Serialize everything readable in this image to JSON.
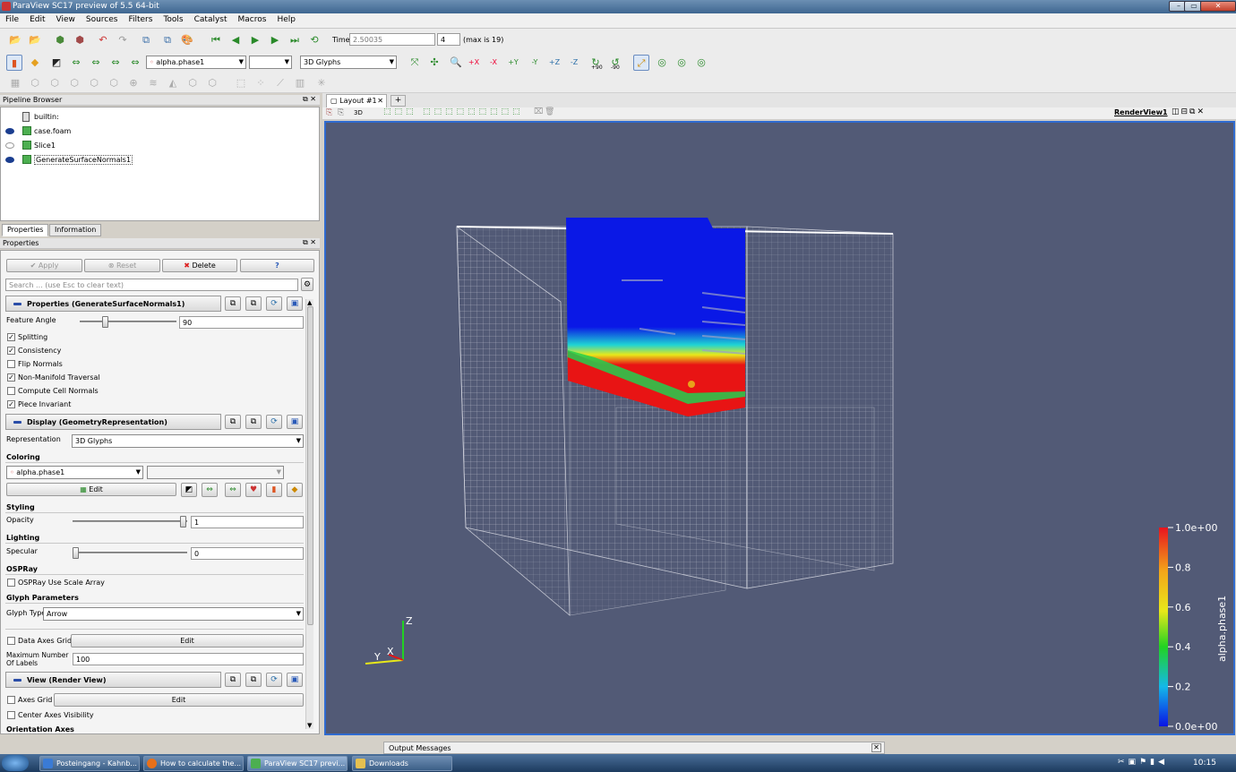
{
  "window": {
    "title": "ParaView SC17 preview of 5.5 64-bit"
  },
  "menu": [
    "File",
    "Edit",
    "View",
    "Sources",
    "Filters",
    "Tools",
    "Catalyst",
    "Macros",
    "Help"
  ],
  "time": {
    "label": "Time:",
    "value": "2.50035",
    "step": "4",
    "max_text": "(max is 19)"
  },
  "toolbar2": {
    "color_array": "alpha.phase1",
    "representation": "3D Glyphs",
    "rot_plus": "+90",
    "rot_minus": "-90"
  },
  "pipeline": {
    "header": "Pipeline Browser",
    "items": [
      "builtin:",
      "case.foam",
      "Slice1",
      "GenerateSurfaceNormals1"
    ]
  },
  "tabs": {
    "properties": "Properties",
    "information": "Information"
  },
  "props": {
    "header": "Properties",
    "apply": "Apply",
    "reset": "Reset",
    "delete": "Delete",
    "help": "?",
    "search_placeholder": "Search ... (use Esc to clear text)",
    "section1": "Properties (GenerateSurfaceNormals1)",
    "feature_angle_label": "Feature Angle",
    "feature_angle_value": "90",
    "feature_angle_fraction": 0.25,
    "checks": [
      {
        "label": "Splitting",
        "checked": true
      },
      {
        "label": "Consistency",
        "checked": true
      },
      {
        "label": "Flip Normals",
        "checked": false
      },
      {
        "label": "Non-Manifold Traversal",
        "checked": true
      },
      {
        "label": "Compute Cell Normals",
        "checked": false
      },
      {
        "label": "Piece Invariant",
        "checked": true
      }
    ],
    "section2": "Display (GeometryRepresentation)",
    "representation_label": "Representation",
    "representation_value": "3D Glyphs",
    "coloring_label": "Coloring",
    "coloring_array": "alpha.phase1",
    "edit_label": "Edit",
    "styling_label": "Styling",
    "opacity_label": "Opacity",
    "opacity_value": "1",
    "opacity_fraction": 1.0,
    "lighting_label": "Lighting",
    "specular_label": "Specular",
    "specular_value": "0",
    "specular_fraction": 0.0,
    "ospray_label": "OSPRay",
    "ospray_scale": "OSPRay Use Scale Array",
    "glyph_params_label": "Glyph Parameters",
    "glyph_type_label": "Glyph Type",
    "glyph_type_value": "Arrow",
    "data_axes_grid": "Data Axes Grid",
    "data_axes_edit": "Edit",
    "max_labels_label": "Maximum Number Of Labels",
    "max_labels_value": "100",
    "section3": "View (Render View)",
    "axes_grid": "Axes Grid",
    "axes_grid_edit": "Edit",
    "center_axes": "Center Axes Visibility",
    "orientation_axes": "Orientation Axes"
  },
  "layout": {
    "tab": "Layout #1",
    "add": "+",
    "view_name": "RenderView1",
    "mode_3d": "3D"
  },
  "colorbar": {
    "title": "alpha.phase1",
    "labels": [
      "1.0e+00",
      "0.8",
      "0.6",
      "0.4",
      "0.2",
      "0.0e+00"
    ]
  },
  "axes": {
    "z": "Z",
    "y": "Y",
    "x": "X"
  },
  "output": {
    "title": "Output Messages"
  },
  "taskbar": {
    "items": [
      "Posteingang - Kahnb...",
      "How to calculate the...",
      "ParaView SC17 previ...",
      "Downloads"
    ],
    "clock": "10:15"
  },
  "colors": {
    "background": "#525a76",
    "selection": "#2f6bd0",
    "phase_high": "#e81414",
    "phase_low": "#0a14e6"
  }
}
